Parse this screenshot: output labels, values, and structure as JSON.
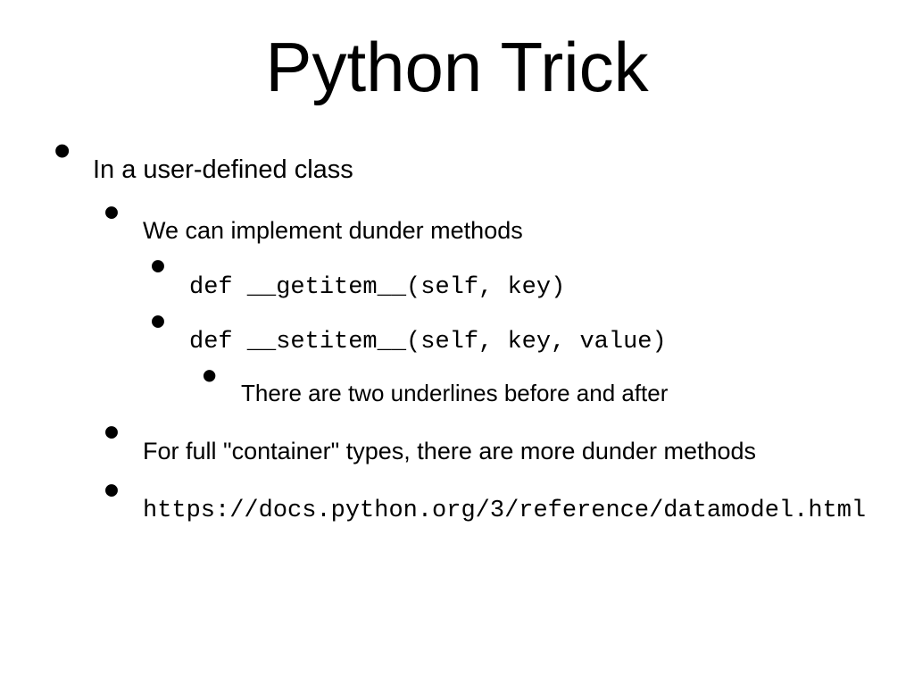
{
  "title": "Python Trick",
  "bullets": {
    "lvl1_a": "In a user-defined class",
    "lvl2_a": "We can implement dunder methods",
    "lvl3_a": "def __getitem__(self, key)",
    "lvl3_b": "def __setitem__(self, key, value)",
    "lvl4_a": "There are two underlines before and after",
    "lvl2_b": "For full \"container\" types, there are more dunder methods",
    "lvl2_c": "https://docs.python.org/3/reference/datamodel.html"
  }
}
